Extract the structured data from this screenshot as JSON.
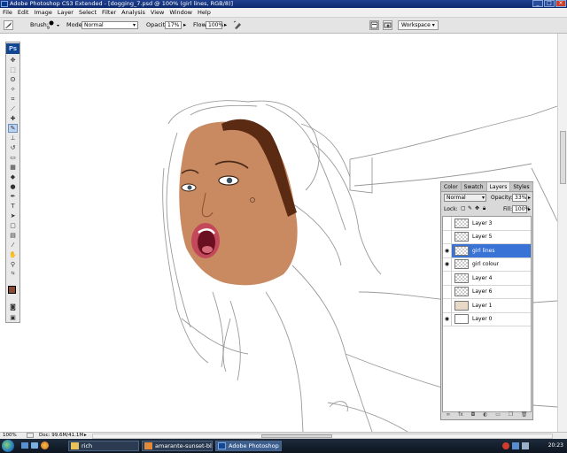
{
  "window": {
    "title": "Adobe Photoshop CS3 Extended - [dogging_7.psd @ 100% (girl lines, RGB/8)]"
  },
  "menu": [
    "File",
    "Edit",
    "Image",
    "Layer",
    "Select",
    "Filter",
    "Analysis",
    "View",
    "Window",
    "Help"
  ],
  "options": {
    "brush_label": "Brush:",
    "brush_size": "9",
    "mode_label": "Mode:",
    "mode_value": "Normal",
    "opacity_label": "Opacity:",
    "opacity_value": "17%",
    "flow_label": "Flow:",
    "flow_value": "100%",
    "workspace_label": "Workspace"
  },
  "layers_panel": {
    "tabs": [
      "Color",
      "Swatch",
      "Layers",
      "Styles"
    ],
    "active_tab": "Layers",
    "blend_mode": "Normal",
    "opacity_label": "Opacity:",
    "opacity_value": "33%",
    "lock_label": "Lock:",
    "fill_label": "Fill:",
    "fill_value": "100%",
    "layers": [
      {
        "name": "Layer 3",
        "visible": false,
        "selected": false
      },
      {
        "name": "Layer 5",
        "visible": false,
        "selected": false
      },
      {
        "name": "girl lines",
        "visible": true,
        "selected": true
      },
      {
        "name": "girl colour",
        "visible": true,
        "selected": false
      },
      {
        "name": "Layer 4",
        "visible": false,
        "selected": false
      },
      {
        "name": "Layer 6",
        "visible": false,
        "selected": false
      },
      {
        "name": "Layer 1",
        "visible": false,
        "selected": false
      },
      {
        "name": "Layer 0",
        "visible": true,
        "selected": false
      }
    ]
  },
  "status": {
    "zoom": "100%",
    "doc": "Doc: 99.6M/41.1M"
  },
  "taskbar": {
    "items": [
      {
        "label": "rich",
        "active": false
      },
      {
        "label": "amarante-sunset-bl...",
        "active": false
      },
      {
        "label": "Adobe Photoshop C...",
        "active": true
      }
    ],
    "clock": "20:23"
  },
  "colors": {
    "foreground": "#8a4a35",
    "background": "#ffffff",
    "skin": "#c98a62",
    "hair": "#5a2a12",
    "selection": "#3a73d6"
  },
  "icons": {
    "tool_active": "brush-icon"
  }
}
